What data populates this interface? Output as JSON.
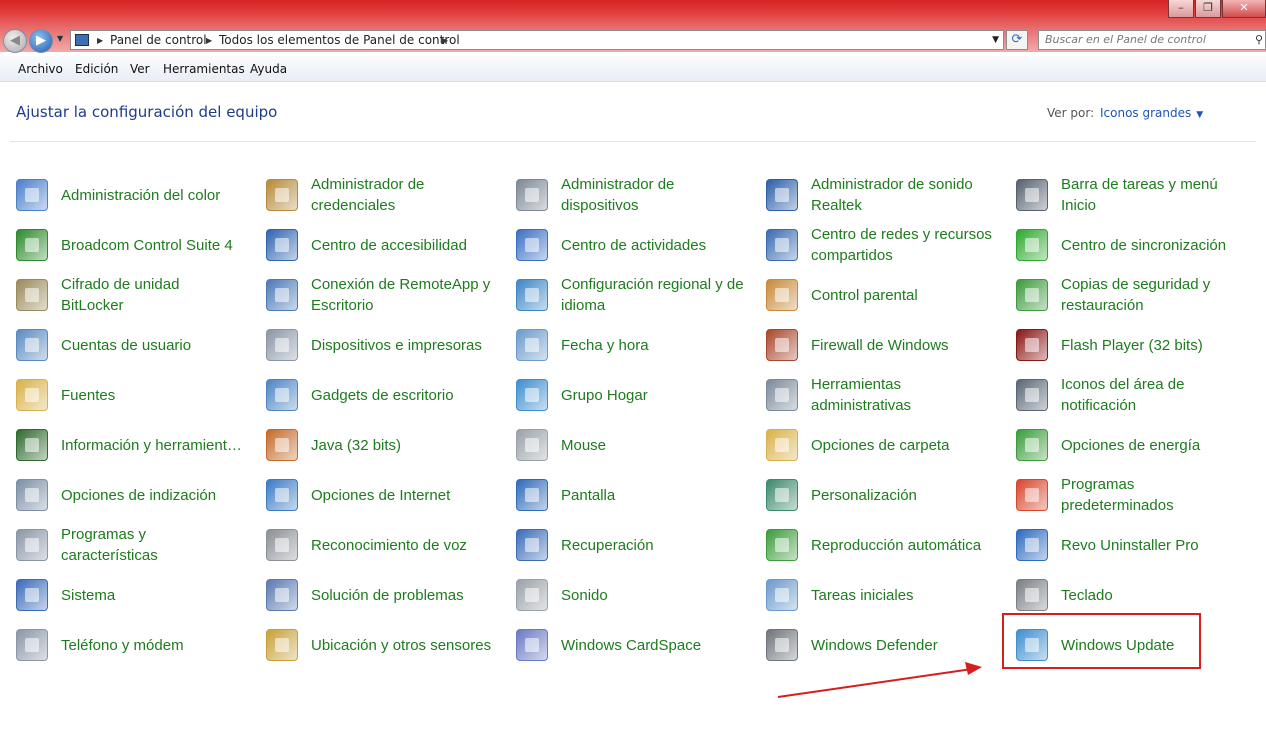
{
  "window": {
    "minimize_glyph": "–",
    "maximize_glyph": "❐",
    "close_glyph": "✕"
  },
  "address": {
    "crumbs": [
      "Panel de control",
      "Todos los elementos de Panel de control"
    ],
    "search_placeholder": "Buscar en el Panel de control"
  },
  "menu": [
    "Archivo",
    "Edición",
    "Ver",
    "Herramientas",
    "Ayuda"
  ],
  "header": {
    "title": "Ajustar la configuración del equipo",
    "view_by_label": "Ver por:",
    "view_by_value": "Iconos grandes"
  },
  "items": [
    {
      "label": "Administración del color",
      "icon": "color-management-icon",
      "color": "#4a7fcb"
    },
    {
      "label": "Administrador de credenciales",
      "icon": "credential-manager-icon",
      "color": "#b58a3a"
    },
    {
      "label": "Administrador de dispositivos",
      "icon": "device-manager-icon",
      "color": "#7d8895"
    },
    {
      "label": "Administrador de sonido Realtek",
      "icon": "realtek-sound-icon",
      "color": "#2d5ea8"
    },
    {
      "label": "Barra de tareas y menú Inicio",
      "icon": "taskbar-icon",
      "color": "#56616f"
    },
    {
      "label": "Broadcom Control Suite 4",
      "icon": "broadcom-icon",
      "color": "#2c8a2c"
    },
    {
      "label": "Centro de accesibilidad",
      "icon": "accessibility-icon",
      "color": "#2f64b0"
    },
    {
      "label": "Centro de actividades",
      "icon": "action-center-flag-icon",
      "color": "#3b6fc4"
    },
    {
      "label": "Centro de redes y recursos compartidos",
      "icon": "network-center-icon",
      "color": "#3a6bb0"
    },
    {
      "label": "Centro de sincronización",
      "icon": "sync-center-icon",
      "color": "#2ea82e"
    },
    {
      "label": "Cifrado de unidad BitLocker",
      "icon": "bitlocker-key-icon",
      "color": "#9a8a5a"
    },
    {
      "label": "Conexión de RemoteApp y Escritorio",
      "icon": "remoteapp-icon",
      "color": "#4c79b8"
    },
    {
      "label": "Configuración regional y de idioma",
      "icon": "globe-clock-icon",
      "color": "#3d86c4"
    },
    {
      "label": "Control parental",
      "icon": "parental-control-icon",
      "color": "#c88a3a"
    },
    {
      "label": "Copias de seguridad y restauración",
      "icon": "backup-icon",
      "color": "#3d9a3d"
    },
    {
      "label": "Cuentas de usuario",
      "icon": "user-accounts-icon",
      "color": "#5b8ac0"
    },
    {
      "label": "Dispositivos e impresoras",
      "icon": "printer-icon",
      "color": "#8a96a6"
    },
    {
      "label": "Fecha y hora",
      "icon": "calendar-clock-icon",
      "color": "#6a9acb"
    },
    {
      "label": "Firewall de Windows",
      "icon": "firewall-icon",
      "color": "#a8472c"
    },
    {
      "label": "Flash Player (32 bits)",
      "icon": "flash-icon",
      "color": "#8a1515"
    },
    {
      "label": "Fuentes",
      "icon": "fonts-folder-icon",
      "color": "#d9b14a"
    },
    {
      "label": "Gadgets de escritorio",
      "icon": "gadgets-icon",
      "color": "#4c84c4"
    },
    {
      "label": "Grupo Hogar",
      "icon": "homegroup-icon",
      "color": "#3e8ed0"
    },
    {
      "label": "Herramientas administrativas",
      "icon": "admin-tools-icon",
      "color": "#7a8a9c"
    },
    {
      "label": "Iconos del área de notificación",
      "icon": "notification-area-icon",
      "color": "#5a6676"
    },
    {
      "label": "Información y herramientas de rendimi...",
      "icon": "performance-icon",
      "color": "#2e6a2e"
    },
    {
      "label": "Java (32 bits)",
      "icon": "java-icon",
      "color": "#c46a2a"
    },
    {
      "label": "Mouse",
      "icon": "mouse-icon",
      "color": "#9aa1a8"
    },
    {
      "label": "Opciones de carpeta",
      "icon": "folder-options-icon",
      "color": "#d9b14a"
    },
    {
      "label": "Opciones de energía",
      "icon": "power-options-icon",
      "color": "#3b9c3b"
    },
    {
      "label": "Opciones de indización",
      "icon": "indexing-icon",
      "color": "#7c8fa6"
    },
    {
      "label": "Opciones de Internet",
      "icon": "internet-options-icon",
      "color": "#3a7bc4"
    },
    {
      "label": "Pantalla",
      "icon": "display-icon",
      "color": "#2f6ab8"
    },
    {
      "label": "Personalización",
      "icon": "personalization-icon",
      "color": "#3c8a6c"
    },
    {
      "label": "Programas predeterminados",
      "icon": "default-programs-icon",
      "color": "#d9442c"
    },
    {
      "label": "Programas y características",
      "icon": "programs-features-icon",
      "color": "#8a96a6"
    },
    {
      "label": "Reconocimiento de voz",
      "icon": "microphone-icon",
      "color": "#8a8f96"
    },
    {
      "label": "Recuperación",
      "icon": "recovery-icon",
      "color": "#3a6bb8"
    },
    {
      "label": "Reproducción automática",
      "icon": "autoplay-icon",
      "color": "#3b9c3b"
    },
    {
      "label": "Revo Uninstaller Pro",
      "icon": "revo-uninstaller-icon",
      "color": "#2e6ac0"
    },
    {
      "label": "Sistema",
      "icon": "system-icon",
      "color": "#3a6bb8"
    },
    {
      "label": "Solución de problemas",
      "icon": "troubleshooting-icon",
      "color": "#5a7ab0"
    },
    {
      "label": "Sonido",
      "icon": "speaker-icon",
      "color": "#9aa1a8"
    },
    {
      "label": "Tareas iniciales",
      "icon": "getting-started-icon",
      "color": "#6a9acb"
    },
    {
      "label": "Teclado",
      "icon": "keyboard-icon",
      "color": "#7a7f86"
    },
    {
      "label": "Teléfono y módem",
      "icon": "phone-modem-icon",
      "color": "#8a96a6"
    },
    {
      "label": "Ubicación y otros sensores",
      "icon": "location-sensors-icon",
      "color": "#c8a03a"
    },
    {
      "label": "Windows CardSpace",
      "icon": "cardspace-icon",
      "color": "#6a7ac4"
    },
    {
      "label": "Windows Defender",
      "icon": "defender-icon",
      "color": "#6f757c"
    },
    {
      "label": "Windows Update",
      "icon": "windows-update-icon",
      "color": "#3e8ed0"
    }
  ],
  "annotation_color": "#d81d1d"
}
